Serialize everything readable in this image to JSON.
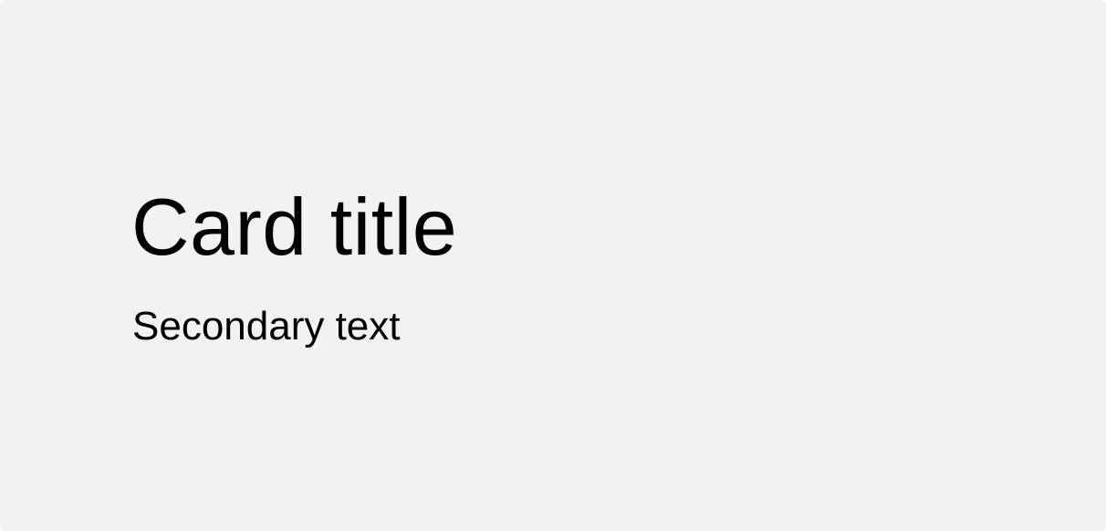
{
  "card": {
    "title": "Card title",
    "secondary_text": "Secondary text"
  },
  "colors": {
    "card_background": "#f2f2f2",
    "text": "#000000"
  }
}
